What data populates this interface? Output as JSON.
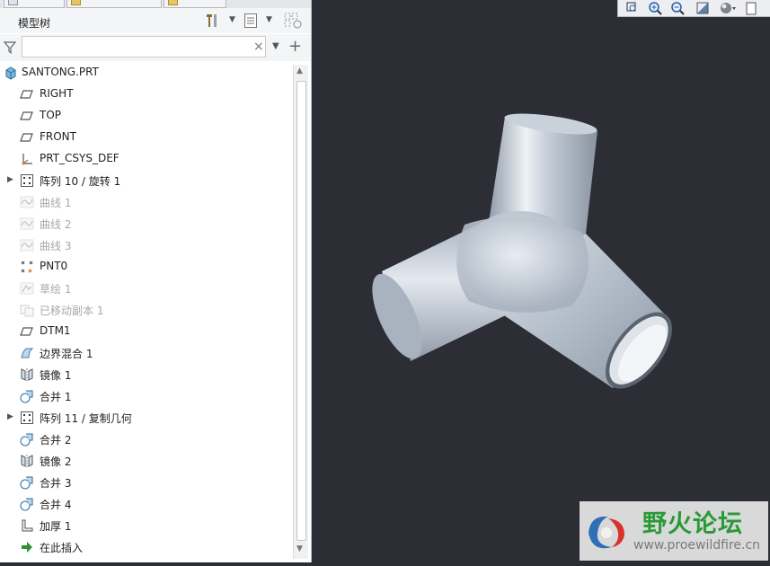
{
  "colors": {
    "viewport_bg": "#2c2d35",
    "panel_bg": "#ffffff",
    "watermark_green": "#2a9a37",
    "pipe": "#b9c3cf"
  },
  "model_tree": {
    "title": "模型树",
    "search_placeholder": "",
    "items": [
      {
        "label": "SANTONG.PRT",
        "icon": "part-icon",
        "dim": false,
        "expandable": false
      },
      {
        "label": "RIGHT",
        "icon": "datum-plane-icon",
        "dim": false,
        "expandable": false
      },
      {
        "label": "TOP",
        "icon": "datum-plane-icon",
        "dim": false,
        "expandable": false
      },
      {
        "label": "FRONT",
        "icon": "datum-plane-icon",
        "dim": false,
        "expandable": false
      },
      {
        "label": "PRT_CSYS_DEF",
        "icon": "csys-icon",
        "dim": false,
        "expandable": false
      },
      {
        "label": "阵列 10 / 旋转 1",
        "icon": "pattern-icon",
        "dim": false,
        "expandable": true
      },
      {
        "label": "曲线 1",
        "icon": "curve-icon",
        "dim": true,
        "expandable": false
      },
      {
        "label": "曲线 2",
        "icon": "curve-icon",
        "dim": true,
        "expandable": false
      },
      {
        "label": "曲线 3",
        "icon": "curve-icon",
        "dim": true,
        "expandable": false
      },
      {
        "label": "PNT0",
        "icon": "datum-point-icon",
        "dim": false,
        "expandable": false
      },
      {
        "label": "草绘 1",
        "icon": "sketch-icon",
        "dim": true,
        "expandable": false
      },
      {
        "label": "已移动副本 1",
        "icon": "moved-copy-icon",
        "dim": true,
        "expandable": false
      },
      {
        "label": "DTM1",
        "icon": "datum-plane-icon",
        "dim": false,
        "expandable": false
      },
      {
        "label": "边界混合 1",
        "icon": "boundary-blend-icon",
        "dim": false,
        "expandable": false
      },
      {
        "label": "镜像 1",
        "icon": "mirror-icon",
        "dim": false,
        "expandable": false
      },
      {
        "label": "合并 1",
        "icon": "merge-icon",
        "dim": false,
        "expandable": false
      },
      {
        "label": "阵列 11 / 复制几何",
        "icon": "pattern-icon",
        "dim": false,
        "expandable": true
      },
      {
        "label": "合并 2",
        "icon": "merge-icon",
        "dim": false,
        "expandable": false
      },
      {
        "label": "镜像 2",
        "icon": "mirror-icon",
        "dim": false,
        "expandable": false
      },
      {
        "label": "合并 3",
        "icon": "merge-icon",
        "dim": false,
        "expandable": false
      },
      {
        "label": "合并 4",
        "icon": "merge-icon",
        "dim": false,
        "expandable": false
      },
      {
        "label": "加厚 1",
        "icon": "thicken-icon",
        "dim": false,
        "expandable": false
      },
      {
        "label": "在此插入",
        "icon": "insert-here-icon",
        "dim": false,
        "expandable": false
      }
    ]
  },
  "watermark": {
    "title": "野火论坛",
    "url": "www.proewildfire.cn"
  }
}
